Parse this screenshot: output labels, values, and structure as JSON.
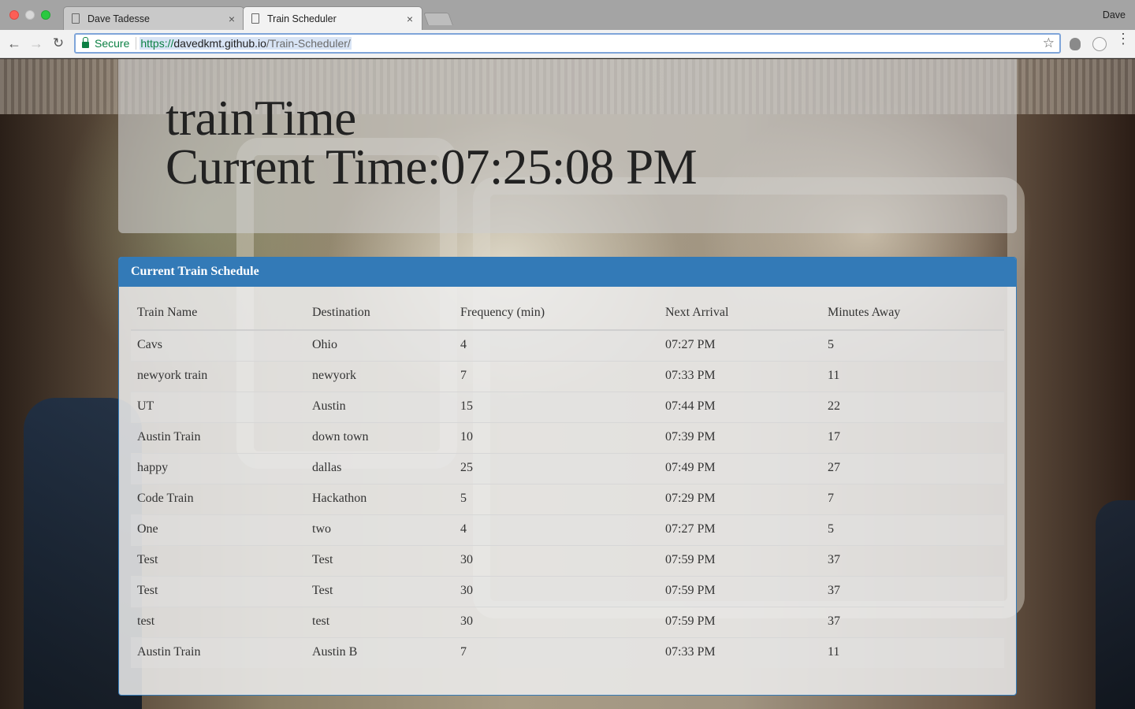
{
  "browser": {
    "tabs": [
      {
        "title": "Dave Tadesse",
        "active": false
      },
      {
        "title": "Train Scheduler",
        "active": true
      }
    ],
    "profile_name": "Dave",
    "omnibox": {
      "secure_label": "Secure",
      "url_scheme": "https://",
      "url_host": "davedkmt.github.io",
      "url_path": "/Train-Scheduler/"
    },
    "icons": {
      "back": "back-arrow-icon",
      "forward": "forward-arrow-icon",
      "reload": "reload-icon",
      "bookmark": "star-icon",
      "menu": "more-vert-icon",
      "close_tab": "×"
    }
  },
  "page": {
    "title": "trainTime",
    "current_time_label": "Current Time:",
    "current_time": "07:25:08 PM",
    "panel_heading": "Current Train Schedule",
    "colors": {
      "primary": "#337ab7"
    },
    "table": {
      "headers": [
        "Train Name",
        "Destination",
        "Frequency (min)",
        "Next Arrival",
        "Minutes Away"
      ],
      "rows": [
        [
          "Cavs",
          "Ohio",
          "4",
          "07:27 PM",
          "5"
        ],
        [
          "newyork train",
          "newyork",
          "7",
          "07:33 PM",
          "11"
        ],
        [
          "UT",
          "Austin",
          "15",
          "07:44 PM",
          "22"
        ],
        [
          "Austin Train",
          "down town",
          "10",
          "07:39 PM",
          "17"
        ],
        [
          "happy",
          "dallas",
          "25",
          "07:49 PM",
          "27"
        ],
        [
          "Code Train",
          "Hackathon",
          "5",
          "07:29 PM",
          "7"
        ],
        [
          "One",
          "two",
          "4",
          "07:27 PM",
          "5"
        ],
        [
          "Test",
          "Test",
          "30",
          "07:59 PM",
          "37"
        ],
        [
          "Test",
          "Test",
          "30",
          "07:59 PM",
          "37"
        ],
        [
          "test",
          "test",
          "30",
          "07:59 PM",
          "37"
        ],
        [
          "Austin Train",
          "Austin B",
          "7",
          "07:33 PM",
          "11"
        ]
      ]
    }
  }
}
